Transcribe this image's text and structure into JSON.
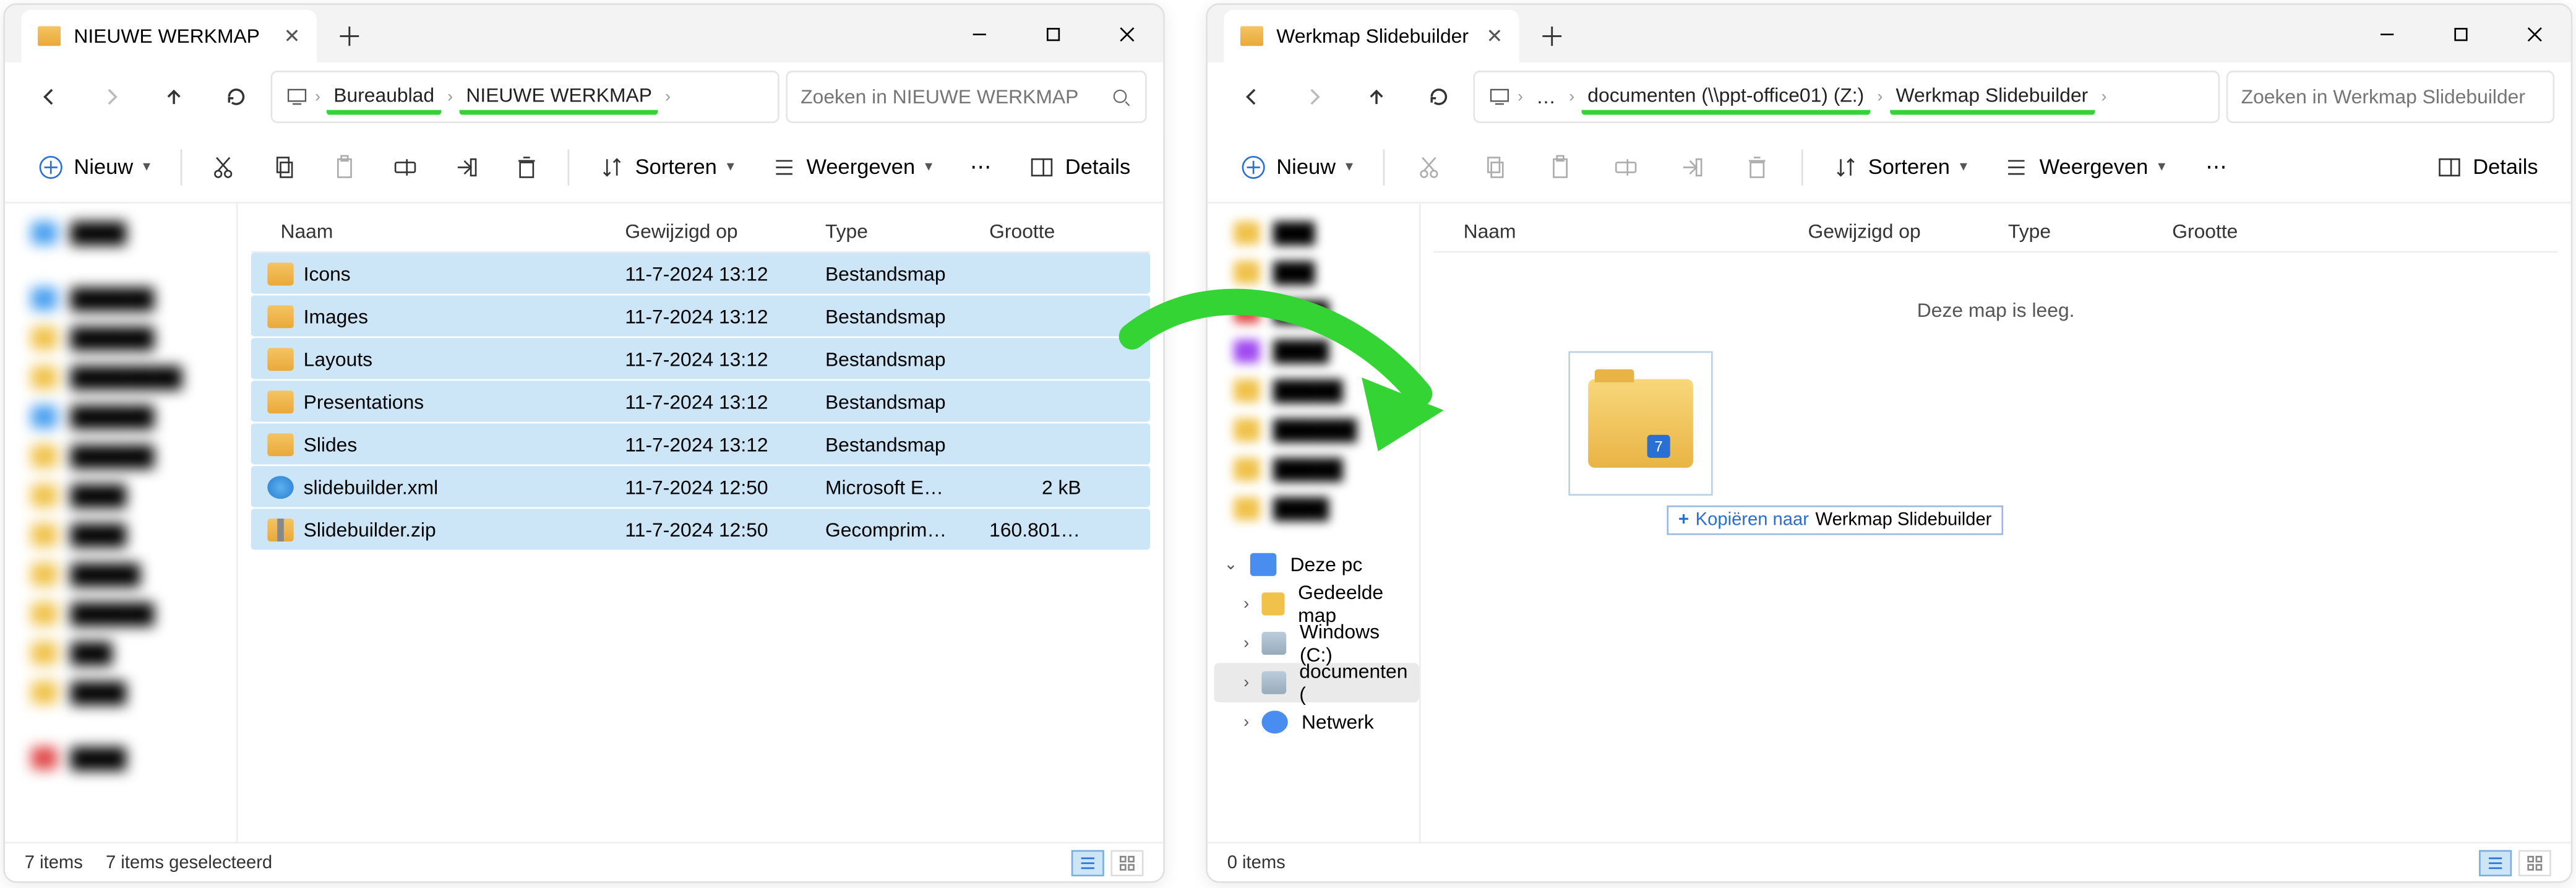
{
  "left": {
    "tab_title": "NIEUWE WERKMAP",
    "breadcrumb": [
      "Bureaublad",
      "NIEUWE WERKMAP"
    ],
    "search_placeholder": "Zoeken in NIEUWE WERKMAP",
    "toolbar": {
      "new": "Nieuw",
      "sort": "Sorteren",
      "view": "Weergeven",
      "details": "Details"
    },
    "columns": {
      "name": "Naam",
      "modified": "Gewijzigd op",
      "type": "Type",
      "size": "Grootte"
    },
    "rows": [
      {
        "name": "Icons",
        "icon": "folder",
        "modified": "11-7-2024 13:12",
        "type": "Bestandsmap",
        "size": ""
      },
      {
        "name": "Images",
        "icon": "folder",
        "modified": "11-7-2024 13:12",
        "type": "Bestandsmap",
        "size": ""
      },
      {
        "name": "Layouts",
        "icon": "folder",
        "modified": "11-7-2024 13:12",
        "type": "Bestandsmap",
        "size": ""
      },
      {
        "name": "Presentations",
        "icon": "folder",
        "modified": "11-7-2024 13:12",
        "type": "Bestandsmap",
        "size": ""
      },
      {
        "name": "Slides",
        "icon": "folder",
        "modified": "11-7-2024 13:12",
        "type": "Bestandsmap",
        "size": ""
      },
      {
        "name": "slidebuilder.xml",
        "icon": "xml",
        "modified": "11-7-2024 12:50",
        "type": "Microsoft Edge H...",
        "size": "2 kB"
      },
      {
        "name": "Slidebuilder.zip",
        "icon": "zip",
        "modified": "11-7-2024 12:50",
        "type": "Gecomprimeerde ...",
        "size": "160.801 kB"
      }
    ],
    "status": {
      "count": "7 items",
      "selected": "7 items geselecteerd"
    }
  },
  "right": {
    "tab_title": "Werkmap Slidebuilder",
    "breadcrumb_prefix": "…",
    "breadcrumb": [
      "documenten (\\\\ppt-office01) (Z:)",
      "Werkmap Slidebuilder"
    ],
    "search_placeholder": "Zoeken in Werkmap Slidebuilder",
    "toolbar": {
      "new": "Nieuw",
      "sort": "Sorteren",
      "view": "Weergeven",
      "details": "Details"
    },
    "columns": {
      "name": "Naam",
      "modified": "Gewijzigd op",
      "type": "Type",
      "size": "Grootte"
    },
    "empty_text": "Deze map is leeg.",
    "tree": {
      "this_pc": "Deze pc",
      "shared": "Gedeelde map",
      "windows": "Windows  (C:)",
      "documenten": "documenten (",
      "network": "Netwerk"
    },
    "drag_badge": "7",
    "copy_hint": {
      "action": "Kopiëren naar",
      "target": "Werkmap Slidebuilder"
    },
    "status": {
      "count": "0 items"
    }
  }
}
